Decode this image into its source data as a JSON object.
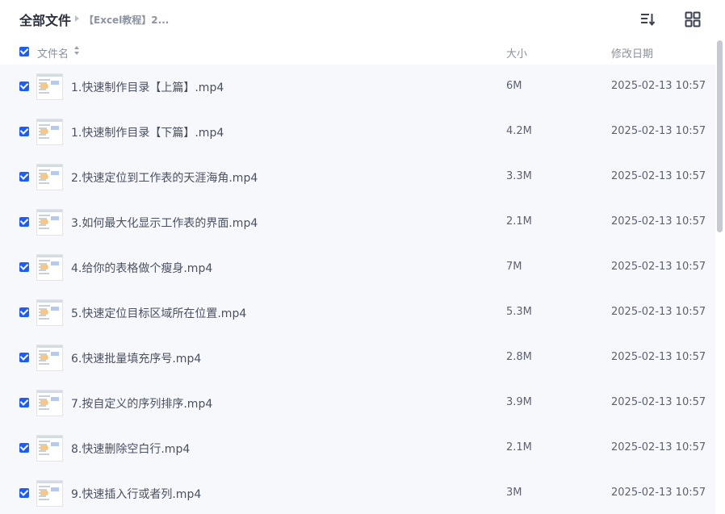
{
  "breadcrumb": {
    "root": "全部文件",
    "current": "【Excel教程】2..."
  },
  "toolbar": {
    "sort_icon": "sort-list-icon",
    "grid_icon": "grid-view-icon"
  },
  "columns": {
    "name": "文件名",
    "size": "大小",
    "modified": "修改日期"
  },
  "colors": {
    "accent": "#1a5cff",
    "list_bg": "#f7f8fb"
  },
  "files": [
    {
      "name": "1.快速制作目录【上篇】.mp4",
      "size": "6M",
      "date": "2025-02-13 10:57",
      "checked": true
    },
    {
      "name": "1.快速制作目录【下篇】.mp4",
      "size": "4.2M",
      "date": "2025-02-13 10:57",
      "checked": true
    },
    {
      "name": "2.快速定位到工作表的天涯海角.mp4",
      "size": "3.3M",
      "date": "2025-02-13 10:57",
      "checked": true
    },
    {
      "name": "3.如何最大化显示工作表的界面.mp4",
      "size": "2.1M",
      "date": "2025-02-13 10:57",
      "checked": true
    },
    {
      "name": "4.给你的表格做个瘦身.mp4",
      "size": "7M",
      "date": "2025-02-13 10:57",
      "checked": true
    },
    {
      "name": "5.快速定位目标区域所在位置.mp4",
      "size": "5.3M",
      "date": "2025-02-13 10:57",
      "checked": true
    },
    {
      "name": "6.快速批量填充序号.mp4",
      "size": "2.8M",
      "date": "2025-02-13 10:57",
      "checked": true
    },
    {
      "name": "7.按自定义的序列排序.mp4",
      "size": "3.9M",
      "date": "2025-02-13 10:57",
      "checked": true
    },
    {
      "name": "8.快速删除空白行.mp4",
      "size": "2.1M",
      "date": "2025-02-13 10:57",
      "checked": true
    },
    {
      "name": "9.快速插入行或者列.mp4",
      "size": "3M",
      "date": "2025-02-13 10:57",
      "checked": true
    }
  ]
}
